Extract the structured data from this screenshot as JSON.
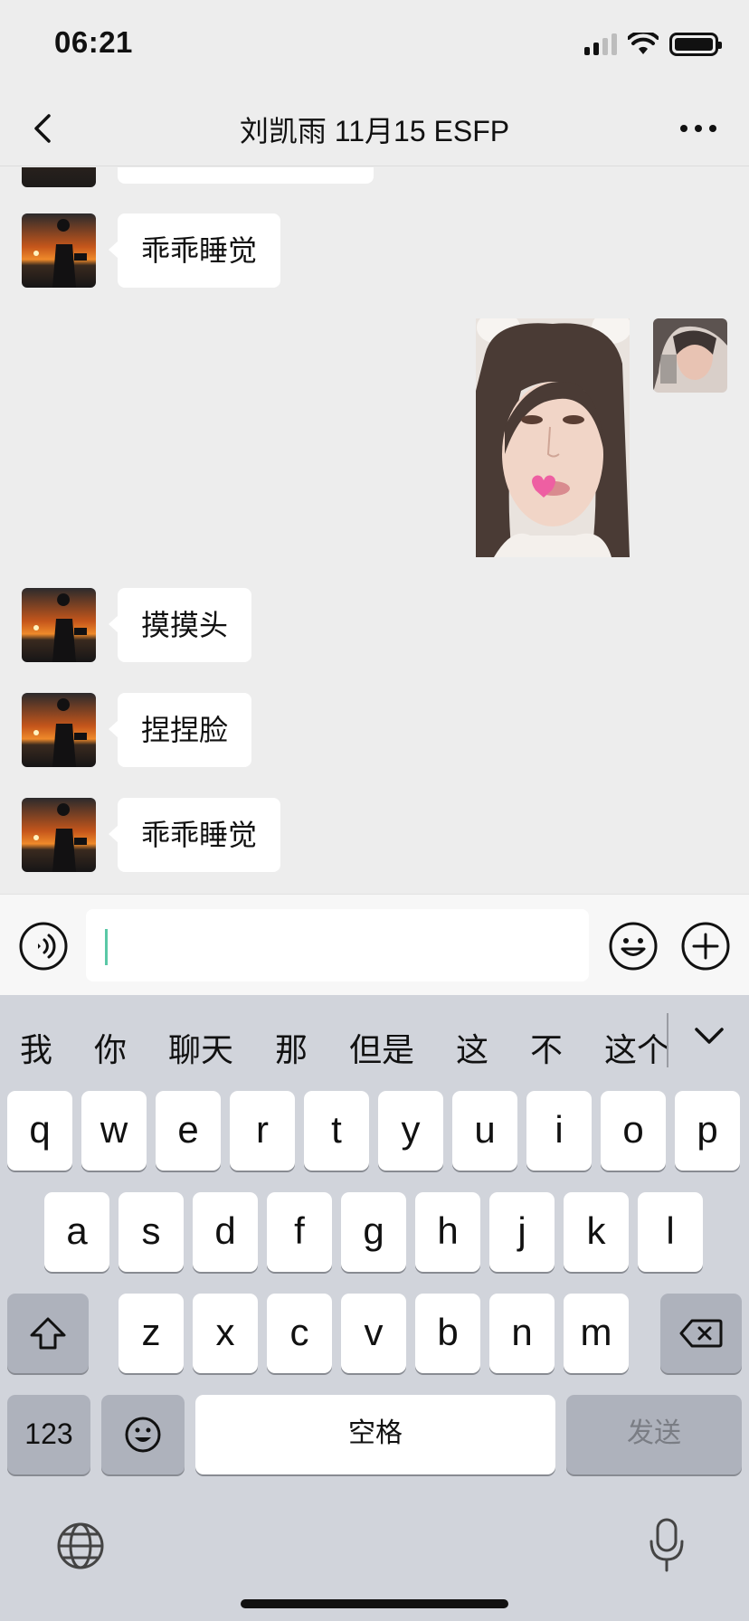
{
  "status_bar": {
    "time": "06:21",
    "icons": [
      "signal-icon",
      "wifi-icon",
      "battery-icon"
    ]
  },
  "nav": {
    "title": "刘凯雨 11月15 ESFP",
    "back_icon": "chevron-left-icon",
    "more_icon": "more-dots-icon"
  },
  "chat": {
    "messages": [
      {
        "sender": "contact",
        "type": "text",
        "text": "乖乖睡觉"
      },
      {
        "sender": "self",
        "type": "image"
      },
      {
        "sender": "contact",
        "type": "text",
        "text": "摸摸头"
      },
      {
        "sender": "contact",
        "type": "text",
        "text": "捏捏脸"
      },
      {
        "sender": "contact",
        "type": "text",
        "text": "乖乖睡觉"
      }
    ]
  },
  "input_bar": {
    "value": "",
    "placeholder": "",
    "voice_icon": "voice-icon",
    "emoji_icon": "emoji-icon",
    "plus_icon": "plus-icon"
  },
  "keyboard": {
    "candidates": [
      "我",
      "你",
      "聊天",
      "那",
      "但是",
      "这",
      "不",
      "这个"
    ],
    "row1": [
      "q",
      "w",
      "e",
      "r",
      "t",
      "y",
      "u",
      "i",
      "o",
      "p"
    ],
    "row2": [
      "a",
      "s",
      "d",
      "f",
      "g",
      "h",
      "j",
      "k",
      "l"
    ],
    "row3": [
      "z",
      "x",
      "c",
      "v",
      "b",
      "n",
      "m"
    ],
    "numbers_label": "123",
    "space_label": "空格",
    "send_label": "发送"
  },
  "colors": {
    "background": "#ededed",
    "bubble": "#ffffff",
    "keyboard": "#d1d4db",
    "function_key": "#aeb2bc",
    "caret": "#5ac8a6"
  }
}
